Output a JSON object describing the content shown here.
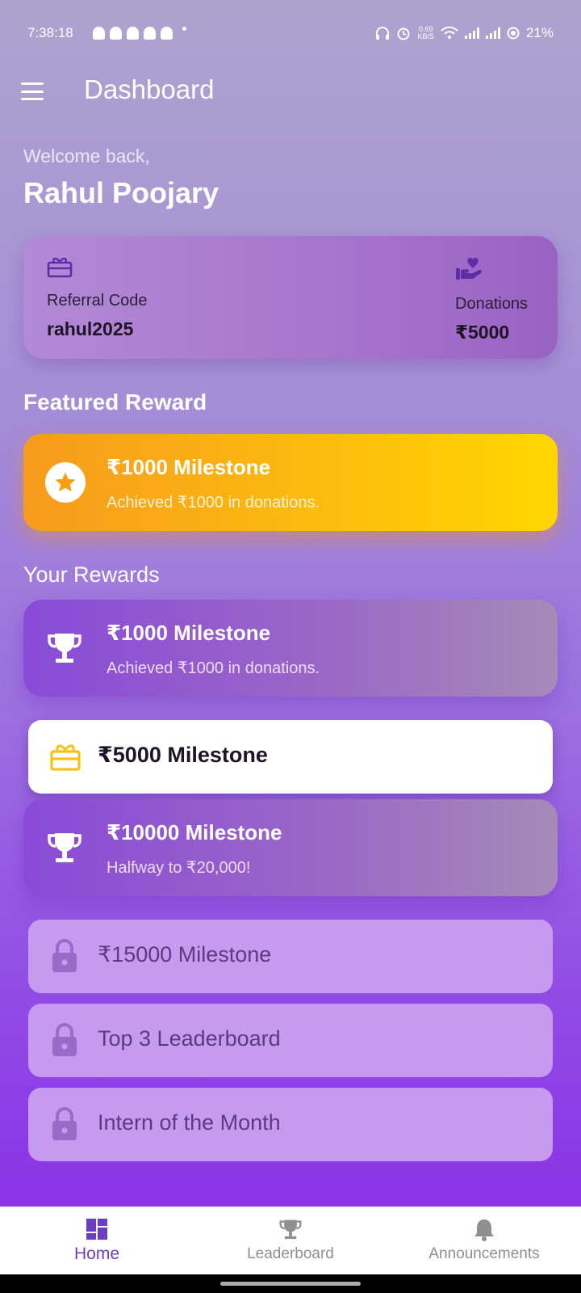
{
  "status": {
    "time": "7:38:18",
    "speed": "0.69",
    "speed_unit": "KB/S",
    "battery": "21%"
  },
  "appbar": {
    "title": "Dashboard"
  },
  "welcome": {
    "greeting": "Welcome back,",
    "name": "Rahul Poojary"
  },
  "info": {
    "referral_label": "Referral Code",
    "referral_value": "rahul2025",
    "donations_label": "Donations",
    "donations_value": "₹5000"
  },
  "featured": {
    "section_title": "Featured Reward",
    "title": "₹1000 Milestone",
    "subtitle": "Achieved ₹1000 in donations."
  },
  "rewards": {
    "section_title": "Your Rewards",
    "achieved": [
      {
        "title": "₹1000 Milestone",
        "subtitle": "Achieved ₹1000 in donations."
      },
      {
        "title": "₹10000 Milestone",
        "subtitle": "Halfway to ₹20,000!"
      }
    ],
    "next": {
      "title": "₹5000 Milestone"
    },
    "locked": [
      {
        "title": "₹15000 Milestone"
      },
      {
        "title": "Top 3 Leaderboard"
      },
      {
        "title": "Intern of the Month"
      }
    ]
  },
  "nav": {
    "home": "Home",
    "leaderboard": "Leaderboard",
    "announcements": "Announcements",
    "active_color": "#6b3fc4",
    "inactive_color": "#8f8f8f"
  },
  "colors": {
    "featured_start": "#f79a1d",
    "featured_end": "#ffd600",
    "accent_purple": "#6b3fc4",
    "gift_yellow": "#f5c21a",
    "lock_purple": "#9a6ac8"
  }
}
